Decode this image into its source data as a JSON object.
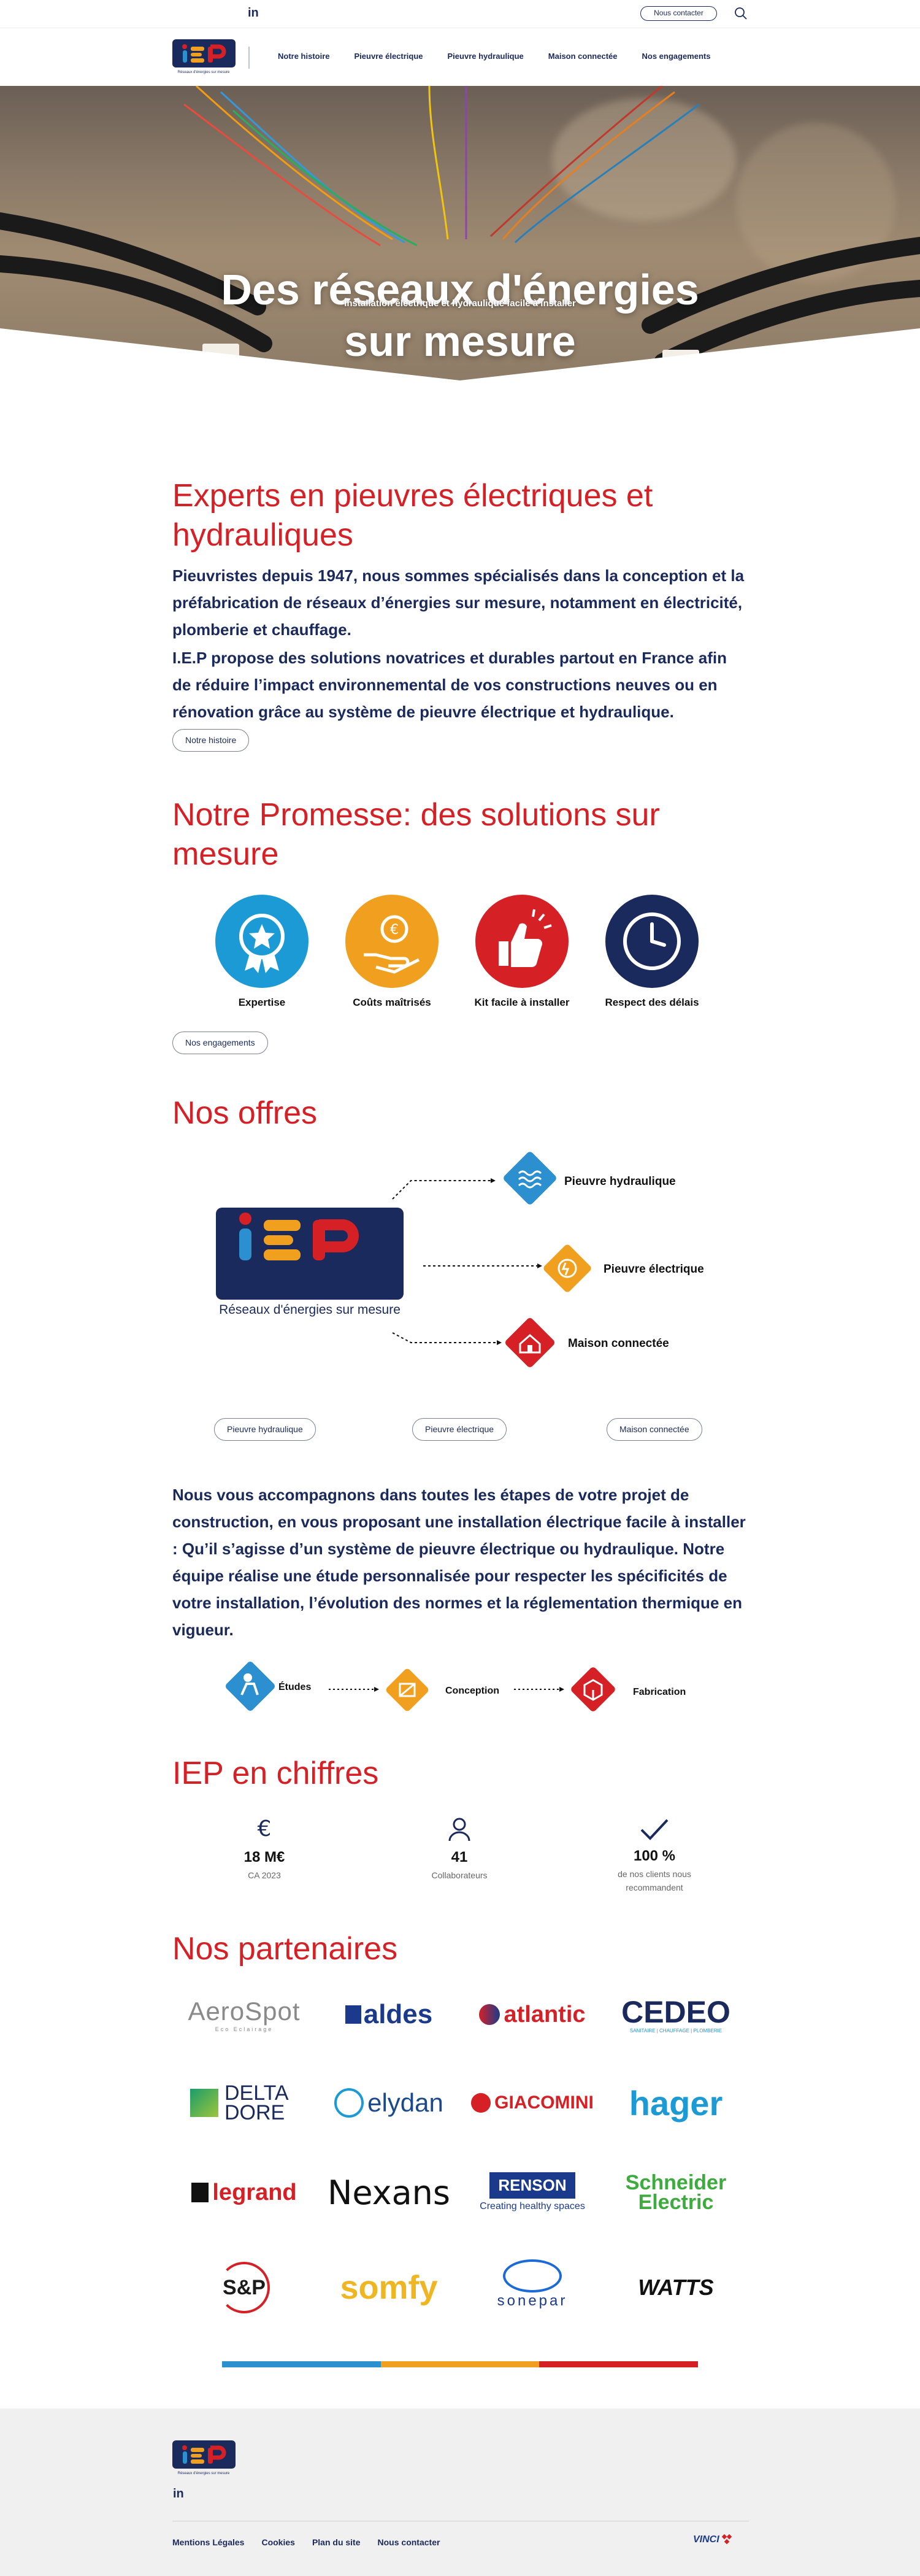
{
  "topbar": {
    "linkedin": "in",
    "contact_label": "Nous contacter"
  },
  "nav": {
    "logo_text": "IEP",
    "logo_tagline": "Réseaux d'énergies sur mesure",
    "items": [
      "Notre histoire",
      "Pieuvre électrique",
      "Pieuvre hydraulique",
      "Maison connectée",
      "Nos engagements"
    ]
  },
  "hero": {
    "title_line1": "Des réseaux d'énergies",
    "title_line2": "sur mesure",
    "subtitle": "Installation électrique et hydraulique facile à installer"
  },
  "experts": {
    "title": "Experts en pieuvres électriques et hydrauliques",
    "p1": "Pieuvristes depuis 1947, nous sommes spécialisés dans la conception et la préfabrication de réseaux d’énergies sur mesure, notamment en électricité, plomberie et chauffage.",
    "p2": "I.E.P propose des solutions novatrices et durables partout en France afin de réduire l’impact environnemental de vos constructions neuves ou en rénovation grâce au système de pieuvre électrique et hydraulique.",
    "button": "Notre histoire"
  },
  "promise": {
    "title": "Notre Promesse: des solutions sur mesure",
    "items": [
      {
        "label": "Expertise",
        "color": "#1b9ad6",
        "icon": "award-icon"
      },
      {
        "label": "Coûts maîtrisés",
        "color": "#f0a01e",
        "icon": "euro-hand-icon"
      },
      {
        "label": "Kit facile à installer",
        "color": "#d52026",
        "icon": "thumbs-up-icon"
      },
      {
        "label": "Respect des délais",
        "color": "#1b2a5c",
        "icon": "clock-icon"
      }
    ],
    "button": "Nos engagements"
  },
  "offers": {
    "title": "Nos offres",
    "logo_text": "IEP",
    "logo_tagline": "Réseaux d'énergies sur mesure",
    "items": [
      {
        "label": "Pieuvre hydraulique",
        "color": "#2b8fd0",
        "icon": "water-icon"
      },
      {
        "label": "Pieuvre électrique",
        "color": "#f0a01e",
        "icon": "plug-icon"
      },
      {
        "label": "Maison connectée",
        "color": "#d52026",
        "icon": "connected-house-icon"
      }
    ],
    "buttons": [
      "Pieuvre hydraulique",
      "Pieuvre électrique",
      "Maison connectée"
    ]
  },
  "accompany": {
    "part1": "Nous vous accompagnons dans toutes les étapes de votre projet de construction, en vous proposant une ",
    "bold1": "installation électrique facile à installer :",
    "part2": " Qu’il s’agisse d’un système de pieuvre électrique ou hydraulique. Notre équipe réalise une étude personnalisée pour respecter les spécificités de votre installation, l’évolution des normes et la réglementation thermique en vigueur."
  },
  "steps": [
    {
      "label": "Études",
      "color": "#2b8fd0",
      "icon": "study-icon"
    },
    {
      "label": "Conception",
      "color": "#f0a01e",
      "icon": "design-icon"
    },
    {
      "label": "Fabrication",
      "color": "#d52026",
      "icon": "box-icon"
    }
  ],
  "figures": {
    "title": "IEP en chiffres",
    "items": [
      {
        "icon": "euro-icon",
        "value": "18 M€",
        "caption": "CA 2023"
      },
      {
        "icon": "person-icon",
        "value": "41",
        "caption": "Collaborateurs"
      },
      {
        "icon": "check-icon",
        "value": "100 %",
        "caption": "de nos clients nous recommandent"
      }
    ]
  },
  "partners": {
    "title": "Nos partenaires",
    "logos": [
      "AeroSpot",
      "aldes",
      "atlantic",
      "CEDEO",
      "DELTA DORE",
      "elydan",
      "GIACOMINI",
      "hager",
      "legrand",
      "Nexans",
      "RENSON",
      "Schneider Electric",
      "S&P",
      "somfy",
      "sonepar",
      "WATTS"
    ],
    "renson_tagline": "Creating healthy spaces",
    "aerospot_tagline": "Eco Eclairage",
    "cedeo_tagline": "SANITAIRE | CHAUFFAGE | PLOMBERIE"
  },
  "colors": {
    "navy": "#1b2a5c",
    "red": "#d52026",
    "blue": "#2b8fd0",
    "orange": "#f0a01e"
  },
  "footer": {
    "logo_text": "IEP",
    "linkedin": "in",
    "links": [
      "Mentions Légales",
      "Cookies",
      "Plan du site",
      "Nous contacter"
    ],
    "vinci": "VINCI"
  }
}
